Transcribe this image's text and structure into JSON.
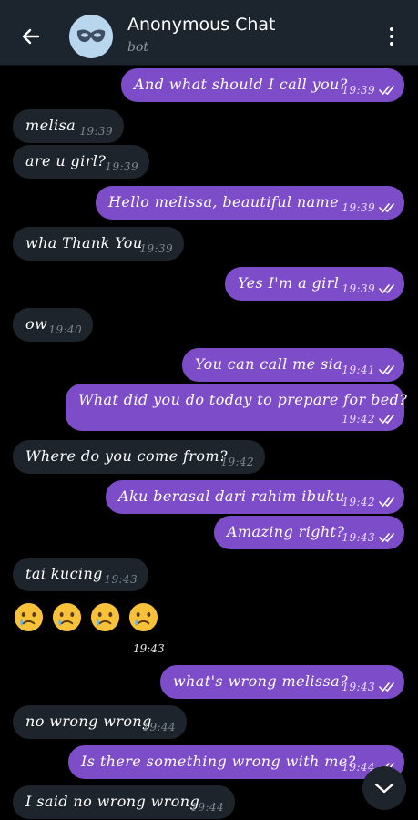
{
  "header": {
    "title": "Anonymous Chat",
    "subtitle": "bot",
    "back_icon": "arrow-left-icon",
    "avatar_icon": "mask-icon",
    "menu_icon": "more-vertical-icon"
  },
  "colors": {
    "outgoing": "#7d4cc8",
    "incoming": "#1d242c",
    "header": "#1c242d",
    "background": "#000000"
  },
  "messages": [
    {
      "dir": "out",
      "text": "And what should I call you?",
      "time": "19:39",
      "read": true
    },
    {
      "dir": "in",
      "text": "melisa",
      "time": "19:39"
    },
    {
      "dir": "in",
      "text": "are u girl?",
      "time": "19:39"
    },
    {
      "dir": "out",
      "text": "Hello melissa, beautiful name",
      "time": "19:39",
      "read": true
    },
    {
      "dir": "in",
      "text": "wha Thank You",
      "time": "19:39"
    },
    {
      "dir": "out",
      "text": "Yes I'm a girl",
      "time": "19:39",
      "read": true
    },
    {
      "dir": "in",
      "text": "ow",
      "time": "19:40"
    },
    {
      "dir": "out",
      "text": "You can call me sia",
      "time": "19:41",
      "read": true
    },
    {
      "dir": "out",
      "text": "What did you do today to prepare for bed?",
      "time": "19:42",
      "read": true
    },
    {
      "dir": "in",
      "text": "Where do you come from?",
      "time": "19:42"
    },
    {
      "dir": "out",
      "text": "Aku berasal dari rahim ibuku",
      "time": "19:42",
      "read": true
    },
    {
      "dir": "out",
      "text": "Amazing right?",
      "time": "19:43",
      "read": true
    },
    {
      "dir": "in",
      "text": "tai kucing",
      "time": "19:43"
    },
    {
      "dir": "in",
      "emoji": [
        "crying-face-emoji",
        "crying-face-emoji",
        "crying-face-emoji",
        "crying-face-emoji"
      ],
      "time": "19:43"
    },
    {
      "dir": "out",
      "text": "what's wrong melissa?",
      "time": "19:43",
      "read": true
    },
    {
      "dir": "in",
      "text": "no wrong wrong",
      "time": "19:44"
    },
    {
      "dir": "out",
      "text": "Is there something wrong with me?",
      "time": "19:44",
      "read": true
    },
    {
      "dir": "in",
      "text": "I said no wrong wrong",
      "time": "19:44"
    }
  ],
  "scroll_down_icon": "chevron-down-icon"
}
